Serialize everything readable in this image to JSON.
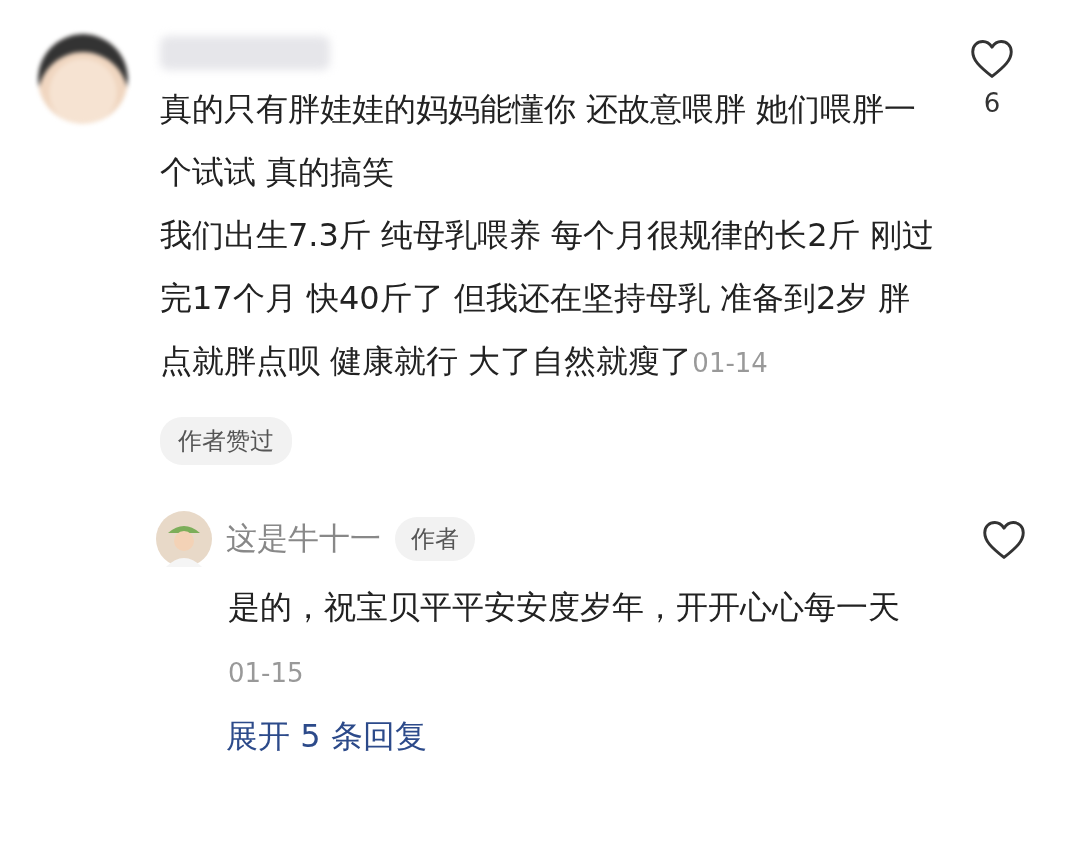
{
  "comment": {
    "paragraphs": [
      "真的只有胖娃娃的妈妈能懂你 还故意喂胖 她们喂胖一个试试 真的搞笑",
      "我们出生7.3斤 纯母乳喂养 每个月很规律的长2斤 刚过完17个月 快40斤了 但我还在坚持母乳 准备到2岁 胖点就胖点呗 健康就行 大了自然就瘦了"
    ],
    "date": "01-14",
    "like_count": "6",
    "liked": false,
    "tag": "作者赞过",
    "reply": {
      "name": "这是牛十一",
      "badge": "作者",
      "text": "是的，祝宝贝平平安安度岁年，开开心心每一天",
      "date": "01-15",
      "liked": false
    },
    "expand_link": "展开 5 条回复"
  }
}
